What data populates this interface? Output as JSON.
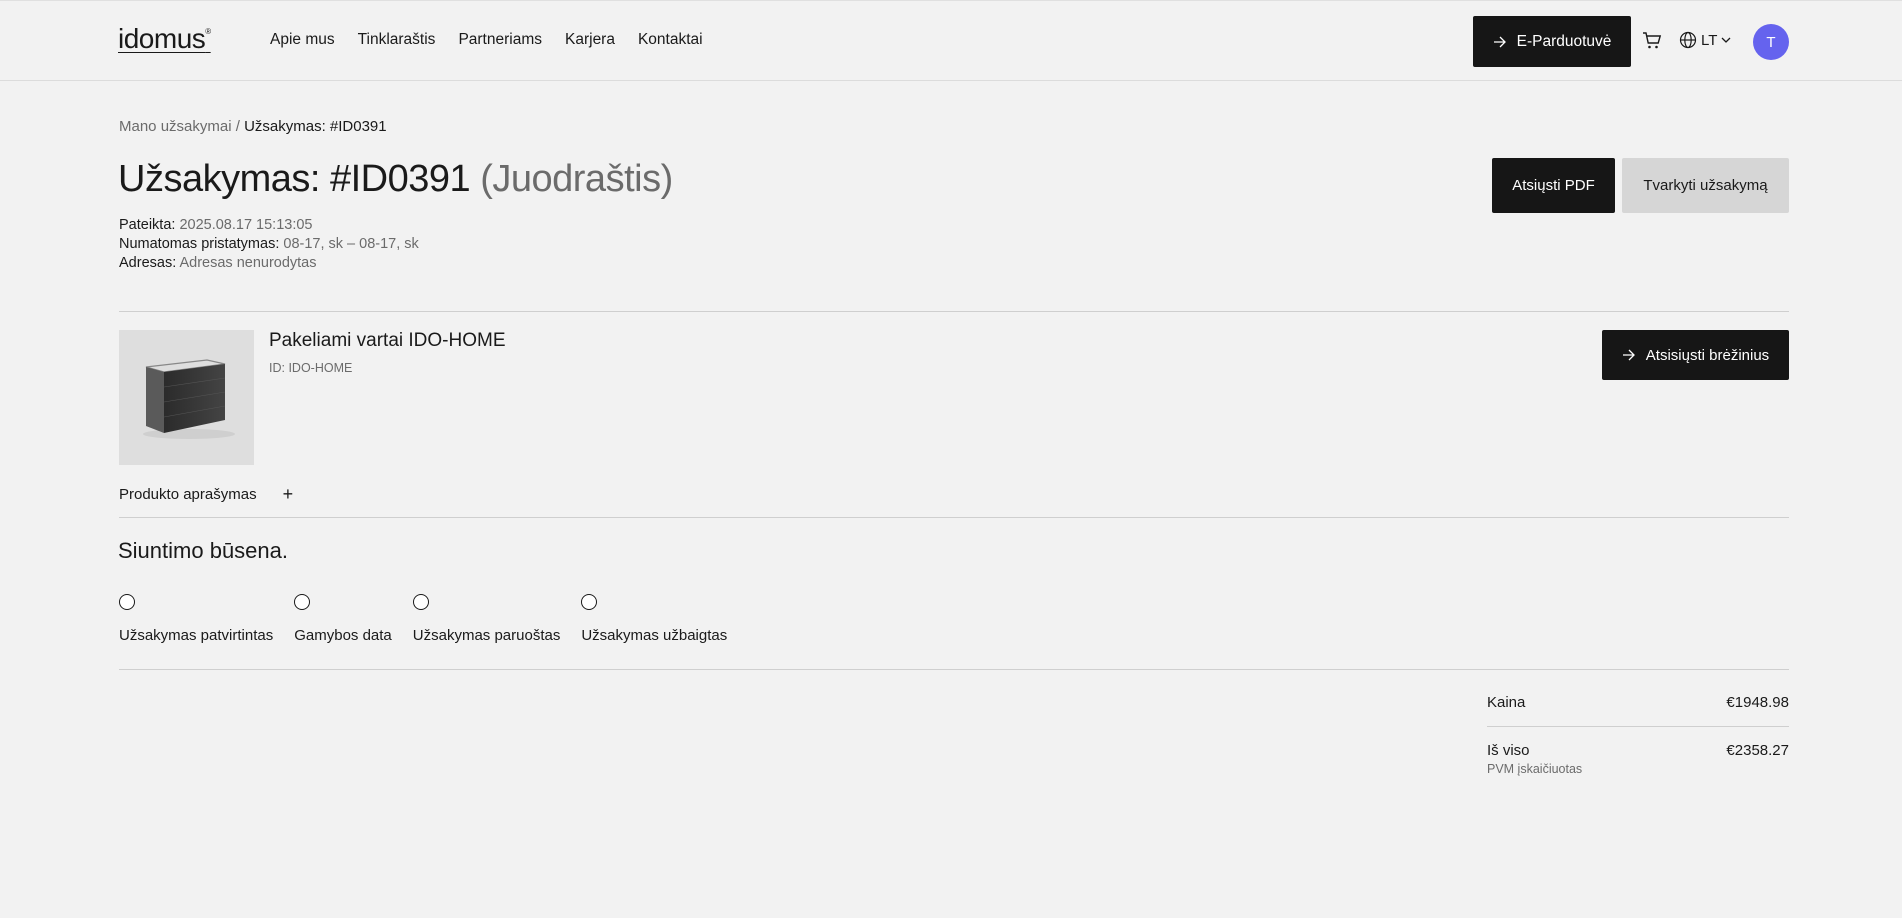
{
  "header": {
    "logo": "idomus",
    "logo_mark": "®",
    "nav": [
      "Apie mus",
      "Tinklaraštis",
      "Partneriams",
      "Karjera",
      "Kontaktai"
    ],
    "eshop_label": "E-Parduotuvė",
    "language": "LT",
    "avatar_initial": "T"
  },
  "breadcrumb": {
    "parent": "Mano užsakymai",
    "separator": "/",
    "current": "Užsakymas: #ID0391"
  },
  "order": {
    "title": "Užsakymas: #ID0391",
    "status": "(Juodraštis)",
    "submitted_label": "Pateikta:",
    "submitted_value": "2025.08.17 15:13:05",
    "delivery_label": "Numatomas pristatymas:",
    "delivery_value": "08-17, sk – 08-17, sk",
    "address_label": "Adresas:",
    "address_value": "Adresas nenurodytas",
    "download_pdf": "Atsiųsti PDF",
    "manage_order": "Tvarkyti užsakymą"
  },
  "product": {
    "name": "Pakeliami vartai IDO-HOME",
    "id": "ID: IDO-HOME",
    "download_drawings": "Atsisiųsti brėžinius",
    "description_label": "Produkto aprašymas",
    "expand_symbol": "+"
  },
  "shipping": {
    "title": "Siuntimo būsena.",
    "steps": [
      "Užsakymas patvirtintas",
      "Gamybos data",
      "Užsakymas paruoštas",
      "Užsakymas užbaigtas"
    ]
  },
  "summary": {
    "price_label": "Kaina",
    "price_value": "€1948.98",
    "total_label": "Iš viso",
    "total_value": "€2358.27",
    "vat_note": "PVM įskaičiuotas"
  },
  "colors": {
    "background": "#f2f2f2",
    "primary_button": "#161616",
    "secondary_button": "#d6d6d6",
    "avatar": "#6563ee"
  },
  "icons": [
    "arrow-right-icon",
    "cart-icon",
    "globe-icon",
    "chevron-down-icon",
    "plus-icon"
  ]
}
